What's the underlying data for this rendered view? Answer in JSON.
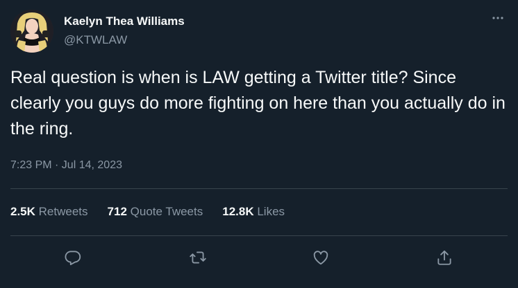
{
  "author": {
    "display_name": "Kaelyn Thea Williams",
    "handle": "@KTWLAW"
  },
  "tweet": {
    "text": "Real question is when is LAW getting a Twitter title? Since clearly you guys do more fighting on here than you actually do in the ring.",
    "timestamp": "7:23 PM · Jul 14, 2023"
  },
  "stats": {
    "retweets_count": "2.5K",
    "retweets_label": "Retweets",
    "quotes_count": "712",
    "quotes_label": "Quote Tweets",
    "likes_count": "12.8K",
    "likes_label": "Likes"
  },
  "icons": {
    "more": "more-options-icon",
    "reply": "reply-icon",
    "retweet": "retweet-icon",
    "like": "like-icon",
    "share": "share-icon"
  },
  "colors": {
    "background": "#15202b",
    "text_primary": "#f7f9f9",
    "text_secondary": "#8b98a5",
    "divider": "#38444d"
  }
}
